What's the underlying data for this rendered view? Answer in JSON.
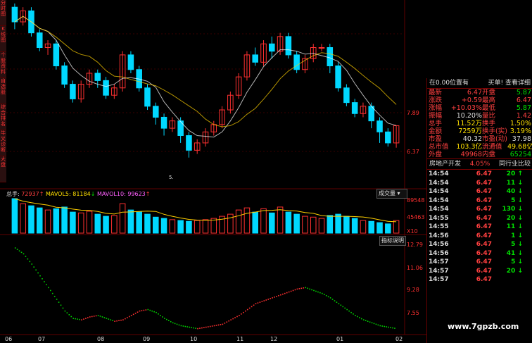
{
  "left_tabs": [
    "分时图",
    "K线图",
    "个股资料",
    "自选股",
    "综合排名",
    "牛叉诊断",
    "大盘"
  ],
  "price_axis": {
    "labels": [
      "7.89",
      "6.37"
    ]
  },
  "volume_axis": {
    "labels": [
      "89548",
      "45463",
      "X10"
    ]
  },
  "indicator_axis": {
    "labels": [
      "12.79",
      "11.06",
      "9.28",
      "7.55"
    ]
  },
  "time_axis": [
    "06",
    "07",
    "08",
    "09",
    "10",
    "11",
    "12",
    "01",
    "02"
  ],
  "low_label": "5.",
  "volume_legend": {
    "total_label": "总手",
    "total": "72937",
    "ma5_label": "MAVOL5:",
    "ma5": "81184",
    "ma10_label": "MAVOL10:",
    "ma10": "99623"
  },
  "volume_dropdown": "成交量",
  "indicator_button": "指标说明",
  "right_panel": {
    "position_label": "在0.00位置有",
    "buy_sell_label": "买单! 查看详细",
    "quotes": [
      {
        "l1": "最新",
        "v1": "6.47",
        "l2": "开盘",
        "v2": "5.87",
        "c1": "red",
        "c2": "green"
      },
      {
        "l1": "涨跌",
        "v1": "+0.59",
        "l2": "最高",
        "v2": "6.47",
        "c1": "red",
        "c2": "red"
      },
      {
        "l1": "涨幅",
        "v1": "+10.03%",
        "l2": "最低",
        "v2": "5.87",
        "c1": "red",
        "c2": "green"
      },
      {
        "l1": "振幅",
        "v1": "10.20%",
        "l2": "量比",
        "v2": "1.42",
        "c1": "white",
        "c2": "red"
      },
      {
        "l1": "总手",
        "v1": "11.52万",
        "l2": "换手",
        "v2": "1.50%",
        "c1": "yellow",
        "c2": "yellow"
      },
      {
        "l1": "金额",
        "v1": "7259万",
        "l2": "换手(实)",
        "v2": "3.19%",
        "c1": "yellow",
        "c2": "yellow"
      },
      {
        "l1": "市盈",
        "v1": "40.32",
        "l2": "市盈(动)",
        "v2": "37.98",
        "c1": "white",
        "c2": "white"
      },
      {
        "l1": "总市值",
        "v1": "103.3亿",
        "l2": "流通值",
        "v2": "49.68亿",
        "c1": "yellow",
        "c2": "yellow"
      },
      {
        "l1": "外盘",
        "v1": "49968",
        "l2": "内盘",
        "v2": "65254",
        "c1": "red",
        "c2": "green"
      }
    ],
    "sector": {
      "name": "房地产开发",
      "pct": "4.05%",
      "compare": "同行业比较"
    },
    "ticks": [
      {
        "time": "14:54",
        "price": "6.47",
        "vol": "20",
        "dir": "↑",
        "c": "green"
      },
      {
        "time": "14:54",
        "price": "6.47",
        "vol": "11",
        "dir": "↓",
        "c": "green"
      },
      {
        "time": "14:54",
        "price": "6.47",
        "vol": "40",
        "dir": "↓",
        "c": "green"
      },
      {
        "time": "14:54",
        "price": "6.47",
        "vol": "5",
        "dir": "↓",
        "c": "green"
      },
      {
        "time": "14:54",
        "price": "6.47",
        "vol": "130",
        "dir": "↓",
        "c": "green"
      },
      {
        "time": "14:55",
        "price": "6.47",
        "vol": "20",
        "dir": "↓",
        "c": "green"
      },
      {
        "time": "14:55",
        "price": "6.47",
        "vol": "11",
        "dir": "↓",
        "c": "green"
      },
      {
        "time": "14:56",
        "price": "6.47",
        "vol": "1",
        "dir": "↓",
        "c": "green"
      },
      {
        "time": "14:56",
        "price": "6.47",
        "vol": "5",
        "dir": "↓",
        "c": "green"
      },
      {
        "time": "14:56",
        "price": "6.47",
        "vol": "41",
        "dir": "↓",
        "c": "green"
      },
      {
        "time": "14:57",
        "price": "6.47",
        "vol": "5",
        "dir": "↓",
        "c": "green"
      },
      {
        "time": "14:57",
        "price": "6.47",
        "vol": "20",
        "dir": "↓",
        "c": "green"
      },
      {
        "time": "14:57",
        "price": "6.47",
        "vol": "",
        "dir": "",
        "c": "green"
      }
    ]
  },
  "watermark": "www.7gpzb.com",
  "colors": {
    "up": "#ff3030",
    "down": "#00d8ff",
    "bg": "#000000",
    "grid": "#600000",
    "ma_white": "#ffffff",
    "ma_yellow": "#ffd000",
    "ma_pink": "#ff60ff"
  },
  "chart_data": {
    "type": "candlestick",
    "price_range": [
      5.0,
      9.8
    ],
    "candles": [
      {
        "o": 9.7,
        "c": 9.3,
        "h": 9.8,
        "l": 9.1
      },
      {
        "o": 9.3,
        "c": 9.6,
        "h": 9.7,
        "l": 9.2
      },
      {
        "o": 9.6,
        "c": 9.0,
        "h": 9.7,
        "l": 8.9
      },
      {
        "o": 9.0,
        "c": 8.6,
        "h": 9.1,
        "l": 8.5
      },
      {
        "o": 8.6,
        "c": 8.7,
        "h": 8.8,
        "l": 8.4
      },
      {
        "o": 8.7,
        "c": 8.1,
        "h": 8.8,
        "l": 8.0
      },
      {
        "o": 8.1,
        "c": 7.6,
        "h": 8.2,
        "l": 7.5
      },
      {
        "o": 7.6,
        "c": 7.2,
        "h": 7.7,
        "l": 7.1
      },
      {
        "o": 7.2,
        "c": 7.6,
        "h": 7.7,
        "l": 7.1
      },
      {
        "o": 7.6,
        "c": 7.9,
        "h": 8.0,
        "l": 7.5
      },
      {
        "o": 7.9,
        "c": 7.7,
        "h": 8.0,
        "l": 7.5
      },
      {
        "o": 7.7,
        "c": 7.3,
        "h": 7.8,
        "l": 7.2
      },
      {
        "o": 7.3,
        "c": 7.5,
        "h": 7.6,
        "l": 7.2
      },
      {
        "o": 7.5,
        "c": 8.4,
        "h": 8.5,
        "l": 7.4
      },
      {
        "o": 8.4,
        "c": 8.0,
        "h": 8.5,
        "l": 7.9
      },
      {
        "o": 8.0,
        "c": 7.5,
        "h": 8.1,
        "l": 7.4
      },
      {
        "o": 7.5,
        "c": 7.0,
        "h": 7.6,
        "l": 6.9
      },
      {
        "o": 7.0,
        "c": 6.7,
        "h": 7.1,
        "l": 6.5
      },
      {
        "o": 6.7,
        "c": 6.4,
        "h": 6.8,
        "l": 6.2
      },
      {
        "o": 6.4,
        "c": 6.6,
        "h": 6.7,
        "l": 6.3
      },
      {
        "o": 6.6,
        "c": 6.2,
        "h": 6.7,
        "l": 6.0
      },
      {
        "o": 6.2,
        "c": 5.8,
        "h": 6.3,
        "l": 5.6
      },
      {
        "o": 5.8,
        "c": 6.0,
        "h": 6.1,
        "l": 5.7
      },
      {
        "o": 6.0,
        "c": 6.3,
        "h": 6.4,
        "l": 5.9
      },
      {
        "o": 6.3,
        "c": 6.5,
        "h": 6.6,
        "l": 6.2
      },
      {
        "o": 6.5,
        "c": 6.9,
        "h": 7.0,
        "l": 6.4
      },
      {
        "o": 6.9,
        "c": 7.3,
        "h": 7.4,
        "l": 6.8
      },
      {
        "o": 7.3,
        "c": 7.8,
        "h": 7.9,
        "l": 7.2
      },
      {
        "o": 7.8,
        "c": 8.4,
        "h": 8.5,
        "l": 7.7
      },
      {
        "o": 8.4,
        "c": 8.2,
        "h": 8.6,
        "l": 8.1
      },
      {
        "o": 8.2,
        "c": 8.7,
        "h": 8.8,
        "l": 8.1
      },
      {
        "o": 8.7,
        "c": 8.5,
        "h": 8.9,
        "l": 8.3
      },
      {
        "o": 8.5,
        "c": 8.9,
        "h": 9.0,
        "l": 8.4
      },
      {
        "o": 8.9,
        "c": 8.4,
        "h": 9.0,
        "l": 8.3
      },
      {
        "o": 8.4,
        "c": 8.0,
        "h": 8.5,
        "l": 7.9
      },
      {
        "o": 8.0,
        "c": 8.3,
        "h": 8.4,
        "l": 7.9
      },
      {
        "o": 8.3,
        "c": 8.6,
        "h": 8.7,
        "l": 8.2
      },
      {
        "o": 8.6,
        "c": 8.6,
        "h": 8.7,
        "l": 8.5
      },
      {
        "o": 8.6,
        "c": 8.1,
        "h": 8.7,
        "l": 7.9
      },
      {
        "o": 8.1,
        "c": 7.5,
        "h": 8.2,
        "l": 7.4
      },
      {
        "o": 7.5,
        "c": 7.1,
        "h": 7.6,
        "l": 7.0
      },
      {
        "o": 7.1,
        "c": 6.8,
        "h": 7.2,
        "l": 6.7
      },
      {
        "o": 6.8,
        "c": 7.0,
        "h": 7.1,
        "l": 6.7
      },
      {
        "o": 7.0,
        "c": 6.6,
        "h": 7.1,
        "l": 6.4
      },
      {
        "o": 6.6,
        "c": 6.3,
        "h": 6.7,
        "l": 6.0
      },
      {
        "o": 6.3,
        "c": 6.0,
        "h": 6.4,
        "l": 5.9
      },
      {
        "o": 6.0,
        "c": 6.47,
        "h": 6.47,
        "l": 5.87
      }
    ],
    "volume": [
      82,
      70,
      65,
      60,
      55,
      58,
      62,
      50,
      48,
      52,
      45,
      40,
      42,
      70,
      55,
      50,
      45,
      38,
      35,
      32,
      30,
      28,
      30,
      32,
      35,
      40,
      45,
      55,
      60,
      50,
      58,
      48,
      62,
      50,
      45,
      40,
      38,
      35,
      42,
      45,
      40,
      35,
      30,
      28,
      25,
      22,
      30
    ],
    "indicator": [
      12.7,
      12.3,
      11.6,
      10.8,
      10.0,
      9.2,
      8.4,
      7.9,
      7.8,
      8.0,
      8.1,
      7.9,
      7.7,
      7.8,
      8.1,
      8.4,
      8.5,
      8.3,
      7.9,
      7.6,
      7.4,
      7.3,
      7.2,
      7.3,
      7.4,
      7.5,
      7.8,
      8.1,
      8.5,
      8.9,
      9.1,
      9.3,
      9.5,
      9.7,
      9.9,
      10.0,
      9.8,
      9.6,
      9.3,
      8.9,
      8.5,
      8.1,
      7.8,
      7.6,
      7.4,
      7.3,
      7.2
    ]
  }
}
